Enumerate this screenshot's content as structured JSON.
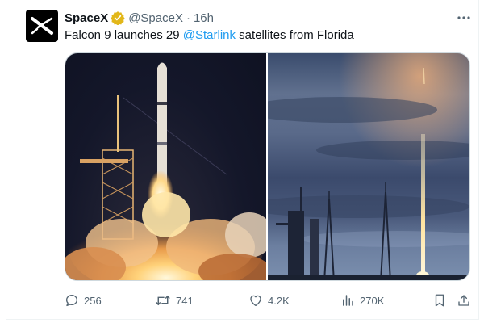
{
  "tweet": {
    "author_name": "SpaceX",
    "handle": "@SpaceX",
    "separator": "·",
    "time": "16h",
    "text_before": "Falcon 9 launches 29 ",
    "mention": "@Starlink",
    "text_after": " satellites from Florida"
  },
  "icons": {
    "avatar": "spacex-x-logo",
    "verified": "verified-badge-gold",
    "more": "more-options-icon",
    "reply": "reply-icon",
    "retweet": "retweet-icon",
    "like": "heart-icon",
    "views": "views-chart-icon",
    "bookmark": "bookmark-icon",
    "share": "share-icon"
  },
  "colors": {
    "mention": "#1d9bf0",
    "secondary_text": "#536471",
    "verified_badge": "#e2b719"
  },
  "actions": {
    "replies": "256",
    "retweets": "741",
    "likes": "4.2K",
    "views": "270K"
  }
}
